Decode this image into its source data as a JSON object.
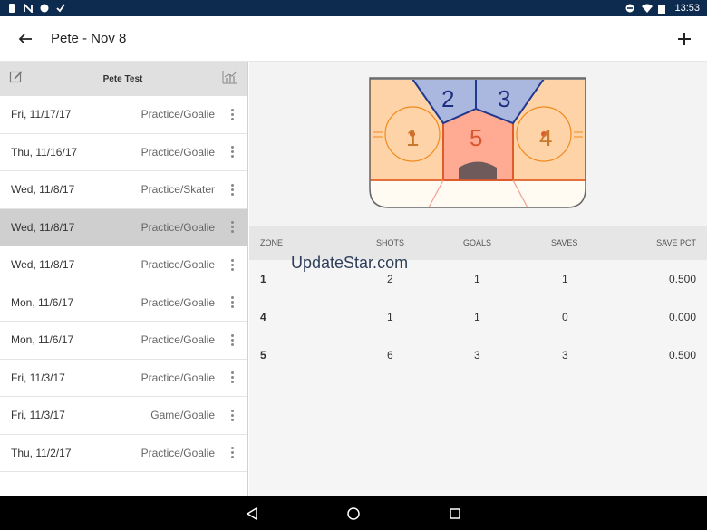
{
  "status_bar": {
    "time": "13:53"
  },
  "app_bar": {
    "title": "Pete - Nov 8"
  },
  "left_pane": {
    "header_name": "Pete Test",
    "sessions": [
      {
        "date": "Fri, 11/17/17",
        "type": "Practice/Goalie",
        "selected": false
      },
      {
        "date": "Thu, 11/16/17",
        "type": "Practice/Goalie",
        "selected": false
      },
      {
        "date": "Wed, 11/8/17",
        "type": "Practice/Skater",
        "selected": false
      },
      {
        "date": "Wed, 11/8/17",
        "type": "Practice/Goalie",
        "selected": true
      },
      {
        "date": "Wed, 11/8/17",
        "type": "Practice/Goalie",
        "selected": false
      },
      {
        "date": "Mon, 11/6/17",
        "type": "Practice/Goalie",
        "selected": false
      },
      {
        "date": "Mon, 11/6/17",
        "type": "Practice/Goalie",
        "selected": false
      },
      {
        "date": "Fri, 11/3/17",
        "type": "Practice/Goalie",
        "selected": false
      },
      {
        "date": "Fri, 11/3/17",
        "type": "Game/Goalie",
        "selected": false
      },
      {
        "date": "Thu, 11/2/17",
        "type": "Practice/Goalie",
        "selected": false
      }
    ]
  },
  "rink": {
    "zones": [
      "1",
      "2",
      "3",
      "4",
      "5"
    ]
  },
  "stats_table": {
    "headers": {
      "zone": "ZONE",
      "shots": "SHOTS",
      "goals": "GOALS",
      "saves": "SAVES",
      "save_pct": "SAVE PCT"
    },
    "rows": [
      {
        "zone": "1",
        "shots": "2",
        "goals": "1",
        "saves": "1",
        "save_pct": "0.500"
      },
      {
        "zone": "4",
        "shots": "1",
        "goals": "1",
        "saves": "0",
        "save_pct": "0.000"
      },
      {
        "zone": "5",
        "shots": "6",
        "goals": "3",
        "saves": "3",
        "save_pct": "0.500"
      }
    ]
  },
  "watermark": "UpdateStar.com",
  "colors": {
    "status_bar": "#0d2a4f",
    "selected_row": "#cfcfcf",
    "zone_blue": "#aab8e0",
    "zone_orange": "#ffd3a8",
    "zone_red": "#ffab94"
  }
}
